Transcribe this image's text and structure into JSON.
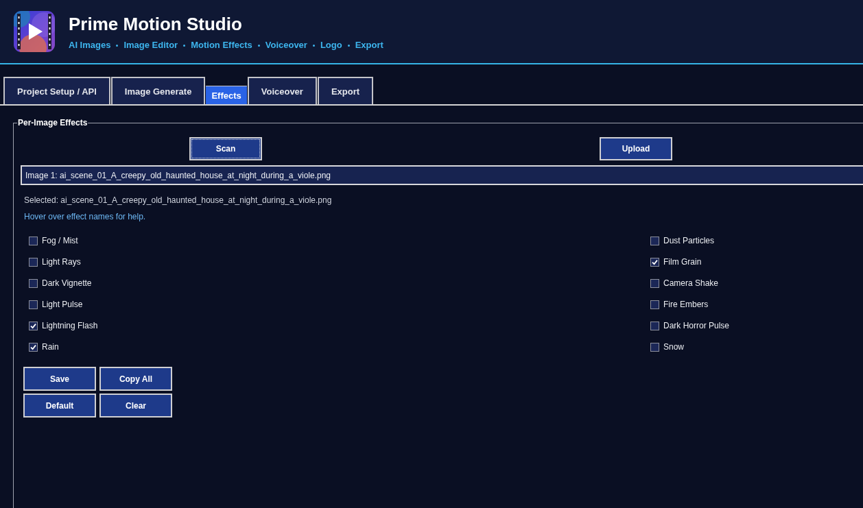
{
  "header": {
    "title": "Prime Motion Studio",
    "nav_links": [
      "AI Images",
      "Image Editor",
      "Motion Effects",
      "Voiceover",
      "Logo",
      "Export"
    ]
  },
  "tabs": [
    {
      "label": "Project Setup / API",
      "selected": false
    },
    {
      "label": "Image Generate",
      "selected": false
    },
    {
      "label": "Effects",
      "selected": true
    },
    {
      "label": "Voiceover",
      "selected": false
    },
    {
      "label": "Export",
      "selected": false
    }
  ],
  "effects_panel": {
    "title": "Per-Image Effects",
    "actions": [
      {
        "label": "Scan",
        "focused": true
      },
      {
        "label": "Upload",
        "focused": false
      }
    ],
    "image_select": {
      "value": "Image 1: ai_scene_01_A_creepy_old_haunted_house_at_night_during_a_viole.png"
    },
    "selected_text": "Selected: ai_scene_01_A_creepy_old_haunted_house_at_night_during_a_viole.png",
    "hint": "Hover over effect names for help.",
    "columns": [
      {
        "effects": [
          {
            "label": "Fog / Mist",
            "checked": false
          },
          {
            "label": "Light Rays",
            "checked": false
          },
          {
            "label": "Dark Vignette",
            "checked": false
          },
          {
            "label": "Light Pulse",
            "checked": false
          },
          {
            "label": "Lightning Flash",
            "checked": true
          },
          {
            "label": "Rain",
            "checked": true
          }
        ]
      },
      {
        "effects": [
          {
            "label": "Dust Particles",
            "checked": false
          },
          {
            "label": "Film Grain",
            "checked": true
          },
          {
            "label": "Camera Shake",
            "checked": false
          },
          {
            "label": "Fire Embers",
            "checked": false
          },
          {
            "label": "Dark Horror Pulse",
            "checked": false
          },
          {
            "label": "Snow",
            "checked": false
          }
        ]
      }
    ],
    "buttons": [
      "Save",
      "Copy All",
      "Default",
      "Clear"
    ]
  }
}
